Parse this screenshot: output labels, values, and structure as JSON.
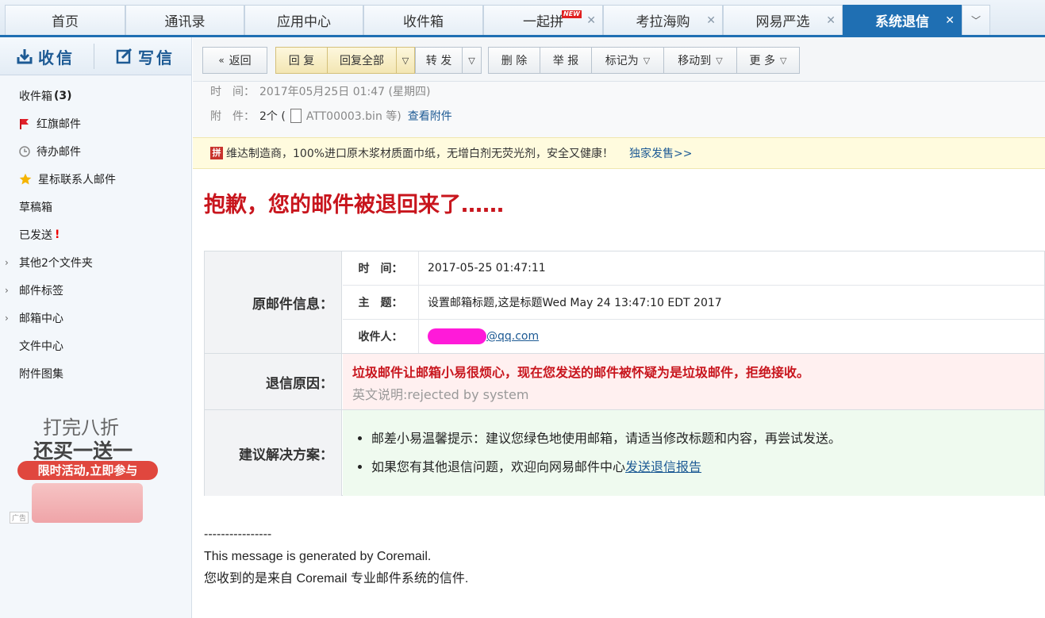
{
  "tabs": [
    {
      "label": "首页"
    },
    {
      "label": "通讯录"
    },
    {
      "label": "应用中心"
    },
    {
      "label": "收件箱"
    },
    {
      "label": "一起拼",
      "badge": "NEW"
    },
    {
      "label": "考拉海购"
    },
    {
      "label": "网易严选"
    },
    {
      "label": "系统退信"
    }
  ],
  "sidebar": {
    "receive": "收信",
    "compose": "写信",
    "items": [
      {
        "label": "收件箱",
        "count": "(3)"
      },
      {
        "label": "红旗邮件"
      },
      {
        "label": "待办邮件"
      },
      {
        "label": "星标联系人邮件"
      },
      {
        "label": "草稿箱"
      },
      {
        "label": "已发送",
        "mark": "!"
      },
      {
        "label": "其他2个文件夹"
      },
      {
        "label": "邮件标签"
      },
      {
        "label": "邮箱中心"
      },
      {
        "label": "文件中心"
      },
      {
        "label": "附件图集"
      }
    ],
    "ad": {
      "line1": "打完八折",
      "line2": "还买一送一",
      "cta": "限时活动,立即参与",
      "tag": "广告"
    }
  },
  "toolbar": {
    "back": "返回",
    "reply": "回 复",
    "reply_all": "回复全部",
    "forward": "转 发",
    "delete": "删 除",
    "report": "举 报",
    "mark_as": "标记为",
    "move_to": "移动到",
    "more": "更 多"
  },
  "message": {
    "time_label": "时　间：",
    "time_value": "2017年05月25日 01:47 (星期四)",
    "attach_label": "附　件：",
    "attach_count": "2个 (",
    "attach_file": "ATT00003.bin 等)",
    "attach_link": "查看附件"
  },
  "banner": {
    "icon": "拼",
    "text": "维达制造商，100%进口原木浆材质面巾纸，无增白剂无荧光剂，安全又健康！",
    "link": "独家发售>>"
  },
  "bounce": {
    "title": "抱歉，您的邮件被退回来了……",
    "orig_label": "原邮件信息：",
    "time_label": "时　间：",
    "time_value": "2017-05-25 01:47:11",
    "subject_label": "主　题：",
    "subject_value": "设置邮箱标题,这是标题Wed May 24 13:47:10 EDT 2017",
    "recipient_label": "收件人：",
    "recipient_value": "@qq.com",
    "reason_label": "退信原因：",
    "reason_text": "垃圾邮件让邮箱小易很烦心，现在您发送的邮件被怀疑为是垃圾邮件，拒绝接收。",
    "reason_en": "英文说明:rejected by system",
    "solution_label": "建议解决方案：",
    "solution_1": "邮差小易温馨提示：建议您绿色地使用邮箱，请适当修改标题和内容，再尝试发送。",
    "solution_2_prefix": "如果您有其他退信问题，欢迎向网易邮件中心",
    "solution_2_link": "发送退信报告"
  },
  "footer": {
    "dashes": "----------------",
    "line1": "This message is generated by Coremail.",
    "line2": "您收到的是来自 Coremail 专业邮件系统的信件."
  },
  "colors": {
    "accent": "#1f6fb3",
    "title_red": "#c8151d",
    "link": "#1d5a94"
  }
}
